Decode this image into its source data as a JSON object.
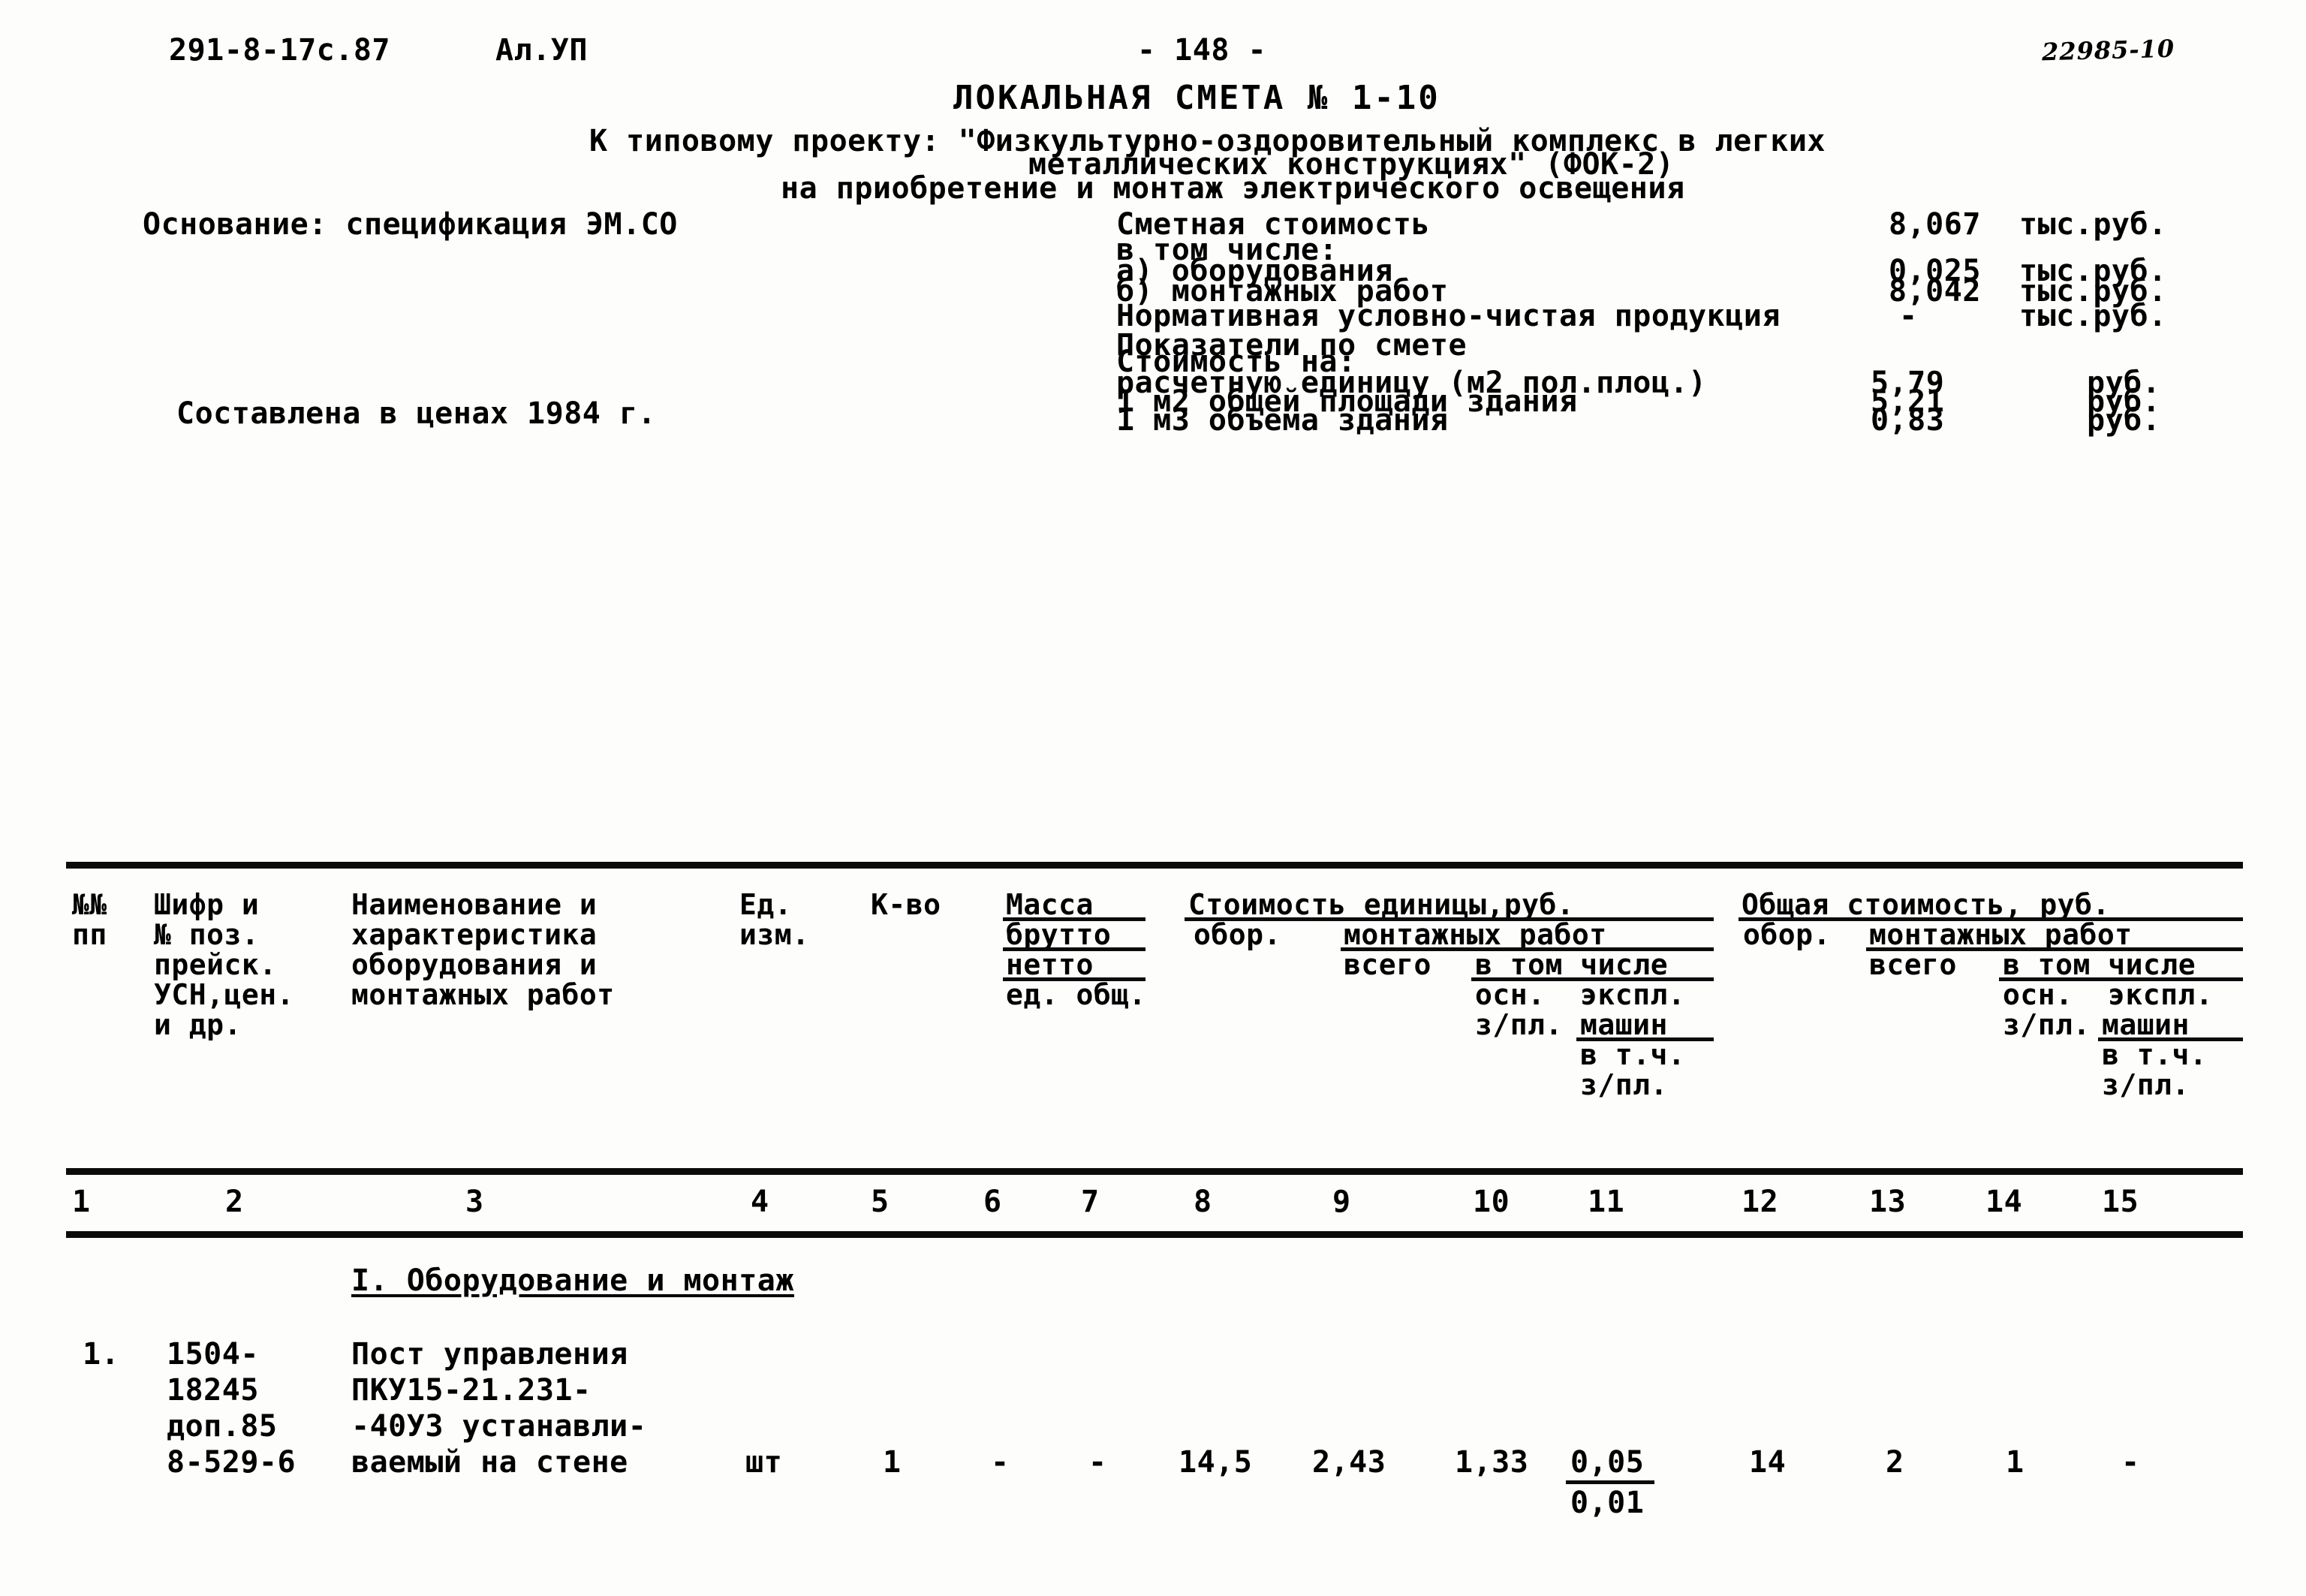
{
  "header": {
    "doc_code": "291-8-17с.87",
    "sheet_label": "Ал.УП",
    "page_number": "- 148 -",
    "archive_stamp": "22985-10"
  },
  "title": {
    "doc_title": "ЛОКАЛЬНАЯ СМЕТА № 1-10",
    "project_line_1": "К типовому проекту: \"Физкультурно-оздоровительный комплекс в легких",
    "project_line_2": "металлических конструкциях\" (ФОК-2)",
    "subject_line": "на приобретение и монтаж электрического освещения"
  },
  "summary": {
    "basis_line": "Основание: спецификация ЭМ.СО",
    "prices_line": "Составлена в ценах 1984 г.",
    "total_label": "Сметная стоимость",
    "total_value": "8,067",
    "total_unit": "тыс.руб.",
    "including_label": "в том числе:",
    "equipment_label": "а) оборудования",
    "equipment_value": "0,025",
    "equipment_unit": "тыс.руб.",
    "install_label": "б) монтажных работ",
    "install_value": "8,042",
    "install_unit": "тыс.руб.",
    "nucp_label": "Нормативная условно-чистая продукция",
    "nucp_value": "-",
    "nucp_unit": "тыс.руб.",
    "indicators_title": "Показатели по смете",
    "indicators_subtitle": "Стоимость на:",
    "indicators": [
      {
        "label": "расчетную единицу (м2 пол.плоц.)",
        "value": "5,79",
        "unit": "руб."
      },
      {
        "label": "1 м2 общей площади здания",
        "value": "5,21",
        "unit": "руб."
      },
      {
        "label": "1 м3 объема здания",
        "value": "0,83",
        "unit": "руб."
      }
    ]
  },
  "table": {
    "headers": {
      "col1": "№№\nпп",
      "col2": "Шифр и\n№ поз.\nпрейск.\nУСН,цен.\nи др.",
      "col3": "Наименование и\nхарактеристика\nоборудования и\nмонтажных работ",
      "col4": "Ед.\nизм.",
      "col5": "К-во",
      "mass_title": "Масса",
      "mass_gross": "брутто",
      "mass_net": "нетто",
      "mass_units": "ед. общ.",
      "unit_cost_title": "Стоимость единицы,руб.",
      "unit_cost_equip": "обор.",
      "unit_cost_install": "монтажных работ",
      "unit_cost_total": "всего",
      "unit_cost_incl": "в том числе",
      "unit_cost_main": "осн.",
      "unit_cost_oper": "экспл.",
      "unit_cost_wage": "з/пл.",
      "unit_cost_machines": "машин",
      "unit_cost_among": "в т.ч.",
      "unit_cost_wage2": "з/пл.",
      "total_cost_title": "Общая стоимость, руб.",
      "total_cost_equip": "обор.",
      "total_cost_install": "монтажных работ",
      "total_cost_total": "всего",
      "total_cost_incl": "в том числе",
      "total_cost_main": "осн.",
      "total_cost_oper": "экспл.",
      "total_cost_wage": "з/пл.",
      "total_cost_machines": "машин",
      "total_cost_among": "в т.ч.",
      "total_cost_wage2": "з/пл."
    },
    "column_numbers": [
      "1",
      "2",
      "3",
      "4",
      "5",
      "6",
      "7",
      "8",
      "9",
      "10",
      "11",
      "12",
      "13",
      "14",
      "15"
    ],
    "section_heading": "I. Оборудование и монтаж",
    "rows": [
      {
        "num": "1.",
        "code": "1504-\n18245\nдоп.85\n8-529-6",
        "name": "Пост управления\nПКУ15-21.231-\n-40У3 устанавли-\nваемый на стене",
        "unit": "шт",
        "qty": "1",
        "mass_gross": "-",
        "mass_net": "-",
        "unit_equip": "14,5",
        "unit_install_total": "2,43",
        "unit_main_wage": "1,33",
        "unit_machines_top": "0,05",
        "unit_machines_bottom": "0,01",
        "total_equip": "14",
        "total_install": "2",
        "total_main_wage": "1",
        "total_machines": "-"
      }
    ]
  }
}
